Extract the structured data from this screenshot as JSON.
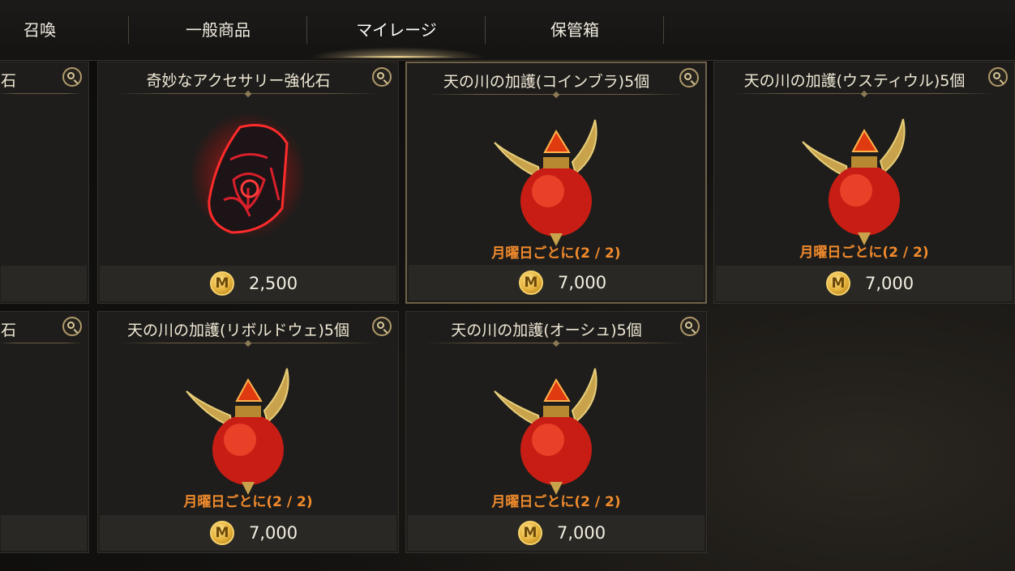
{
  "tabs": [
    {
      "label": "召喚"
    },
    {
      "label": "一般商品"
    },
    {
      "label": "マイレージ"
    },
    {
      "label": "保管箱"
    }
  ],
  "active_tab": "マイレージ",
  "currency_icon": "M",
  "colors": {
    "limit_text": "#f08a2c",
    "coin_gold": "#e4b03a",
    "selected_border": "#6e6248"
  },
  "items": [
    {
      "title": "石",
      "price": "",
      "partial": true
    },
    {
      "title": "奇妙なアクセサリー強化石",
      "icon": "accessory-enhancement-stone-icon",
      "limit": "",
      "price": "2,500"
    },
    {
      "title": "天の川の加護(コインブラ)5個",
      "icon": "winged-potion-icon",
      "limit": "月曜日ごとに(2 / 2)",
      "price": "7,000"
    },
    {
      "title": "天の川の加護(ウスティウル)5個",
      "icon": "winged-potion-icon",
      "limit": "月曜日ごとに(2 / 2)",
      "price": "7,000"
    },
    {
      "title": "石",
      "price": "",
      "partial": true
    },
    {
      "title": "天の川の加護(リボルドウェ)5個",
      "icon": "winged-potion-icon",
      "limit": "月曜日ごとに(2 / 2)",
      "price": "7,000"
    },
    {
      "title": "天の川の加護(オーシュ)5個",
      "icon": "winged-potion-icon",
      "limit": "月曜日ごとに(2 / 2)",
      "price": "7,000"
    }
  ]
}
